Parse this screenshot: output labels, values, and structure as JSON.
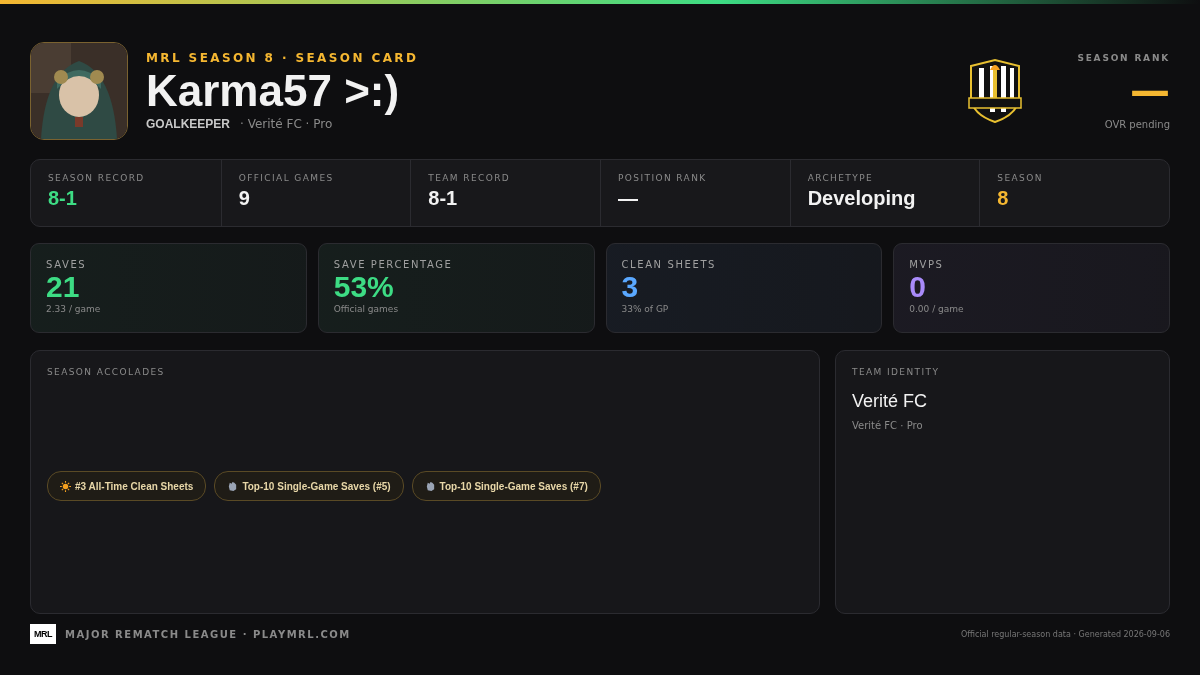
{
  "header": {
    "eyebrow": "MRL SEASON 8 · SEASON CARD",
    "player_name": "Karma57 >:)",
    "position": "GOALKEEPER",
    "team_line": "· Verité FC · Pro"
  },
  "season_rank": {
    "label": "SEASON RANK",
    "value": "—",
    "note": "OVR pending"
  },
  "summary": [
    {
      "label": "SEASON RECORD",
      "value": "8-1",
      "color": "#3ddc84"
    },
    {
      "label": "OFFICIAL GAMES",
      "value": "9",
      "color": "#f2f2f2"
    },
    {
      "label": "TEAM RECORD",
      "value": "8-1",
      "color": "#f2f2f2"
    },
    {
      "label": "POSITION RANK",
      "value": "—",
      "color": "#f2f2f2"
    },
    {
      "label": "ARCHETYPE",
      "value": "Developing",
      "color": "#f2f2f2"
    },
    {
      "label": "SEASON",
      "value": "8",
      "color": "#f5b731"
    }
  ],
  "stats": [
    {
      "label": "SAVES",
      "value": "21",
      "sub": "2.33 / game",
      "color": "#3ddc84"
    },
    {
      "label": "SAVE PERCENTAGE",
      "value": "53%",
      "sub": "Official games",
      "color": "#3ddc84"
    },
    {
      "label": "CLEAN SHEETS",
      "value": "3",
      "sub": "33% of GP",
      "color": "#5aa8ff"
    },
    {
      "label": "MVPS",
      "value": "0",
      "sub": "0.00 / game",
      "color": "#a98bfa"
    }
  ],
  "accolades": {
    "title": "SEASON ACCOLADES",
    "items": [
      {
        "kind": "sun",
        "label": "#3 All-Time Clean Sheets"
      },
      {
        "kind": "glove",
        "label": "Top-10 Single-Game Saves (#5)"
      },
      {
        "kind": "glove",
        "label": "Top-10 Single-Game Saves (#7)"
      }
    ]
  },
  "team_identity": {
    "title": "TEAM IDENTITY",
    "name": "Verité FC",
    "sub": "Verité FC · Pro"
  },
  "footer": {
    "logo_text": "MRL",
    "league": "MAJOR REMATCH LEAGUE · PLAYMRL.COM",
    "note": "Official regular-season data · Generated 2026-09-06"
  }
}
